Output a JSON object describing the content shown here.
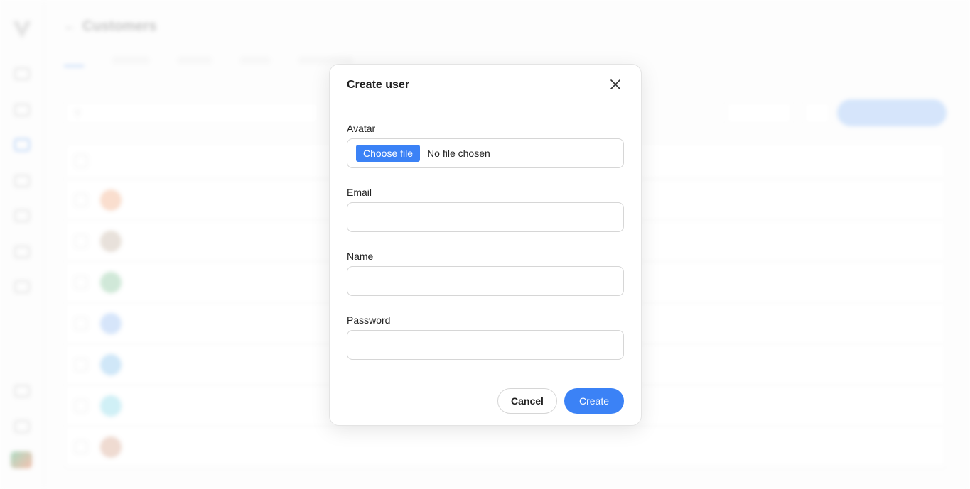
{
  "background": {
    "page_title": "Customers",
    "colors": {
      "accent": "#4a90f0",
      "add_button": "#9cc3f7"
    },
    "rows": [
      {
        "avatar_color": "#f3b08a"
      },
      {
        "avatar_color": "#c9b8a8"
      },
      {
        "avatar_color": "#8fcaa2"
      },
      {
        "avatar_color": "#9ec2f5"
      },
      {
        "avatar_color": "#8dc6ef"
      },
      {
        "avatar_color": "#8fdbea"
      },
      {
        "avatar_color": "#d9a892"
      }
    ]
  },
  "modal": {
    "title": "Create user",
    "close_icon": "close-icon",
    "avatar": {
      "label": "Avatar",
      "button_label": "Choose file",
      "status": "No file chosen"
    },
    "email": {
      "label": "Email",
      "value": "",
      "placeholder": ""
    },
    "name": {
      "label": "Name",
      "value": "",
      "placeholder": ""
    },
    "password": {
      "label": "Password",
      "value": "",
      "placeholder": ""
    },
    "cancel_label": "Cancel",
    "create_label": "Create",
    "colors": {
      "primary": "#3b82f6",
      "border": "#d6d6d6"
    }
  }
}
